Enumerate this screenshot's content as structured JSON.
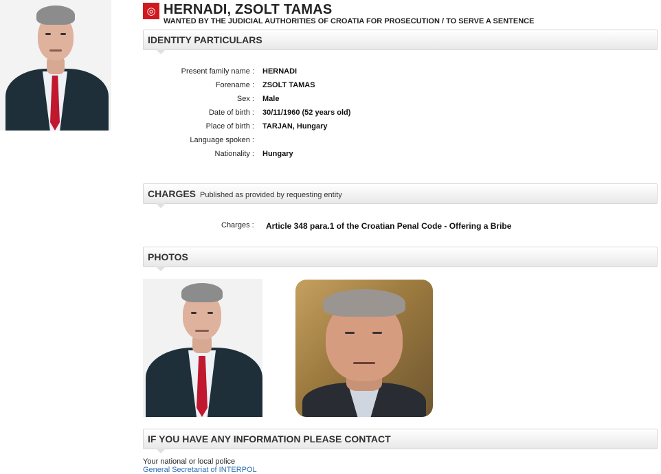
{
  "header": {
    "logo_glyph": "◎",
    "title": "HERNADI, ZSOLT TAMAS",
    "subtitle": "WANTED BY THE JUDICIAL AUTHORITIES OF CROATIA FOR PROSECUTION / TO SERVE A SENTENCE"
  },
  "identity": {
    "heading": "IDENTITY PARTICULARS",
    "rows": [
      {
        "label": "Present family name :",
        "value": "HERNADI"
      },
      {
        "label": "Forename :",
        "value": "ZSOLT TAMAS"
      },
      {
        "label": "Sex :",
        "value": "Male"
      },
      {
        "label": "Date of birth :",
        "value": "30/11/1960 (52 years old)"
      },
      {
        "label": "Place of birth :",
        "value": "TARJAN, Hungary"
      },
      {
        "label": "Language spoken :",
        "value": ""
      },
      {
        "label": "Nationality :",
        "value": "Hungary"
      }
    ]
  },
  "charges": {
    "heading": "CHARGES",
    "subheading": "Published as provided by requesting entity",
    "label": "Charges :",
    "value": "Article 348 para.1 of the Croatian Penal Code - Offering a Bribe"
  },
  "photos": {
    "heading": "PHOTOS"
  },
  "contact": {
    "heading": "IF YOU HAVE ANY INFORMATION PLEASE CONTACT",
    "line1": "Your national or local police",
    "link": "General Secretariat of INTERPOL"
  },
  "colors": {
    "logo_red": "#d01a20",
    "link_blue": "#2a6fb7",
    "tie_red": "#c0182f",
    "suit_dark": "#1e2f3a"
  }
}
